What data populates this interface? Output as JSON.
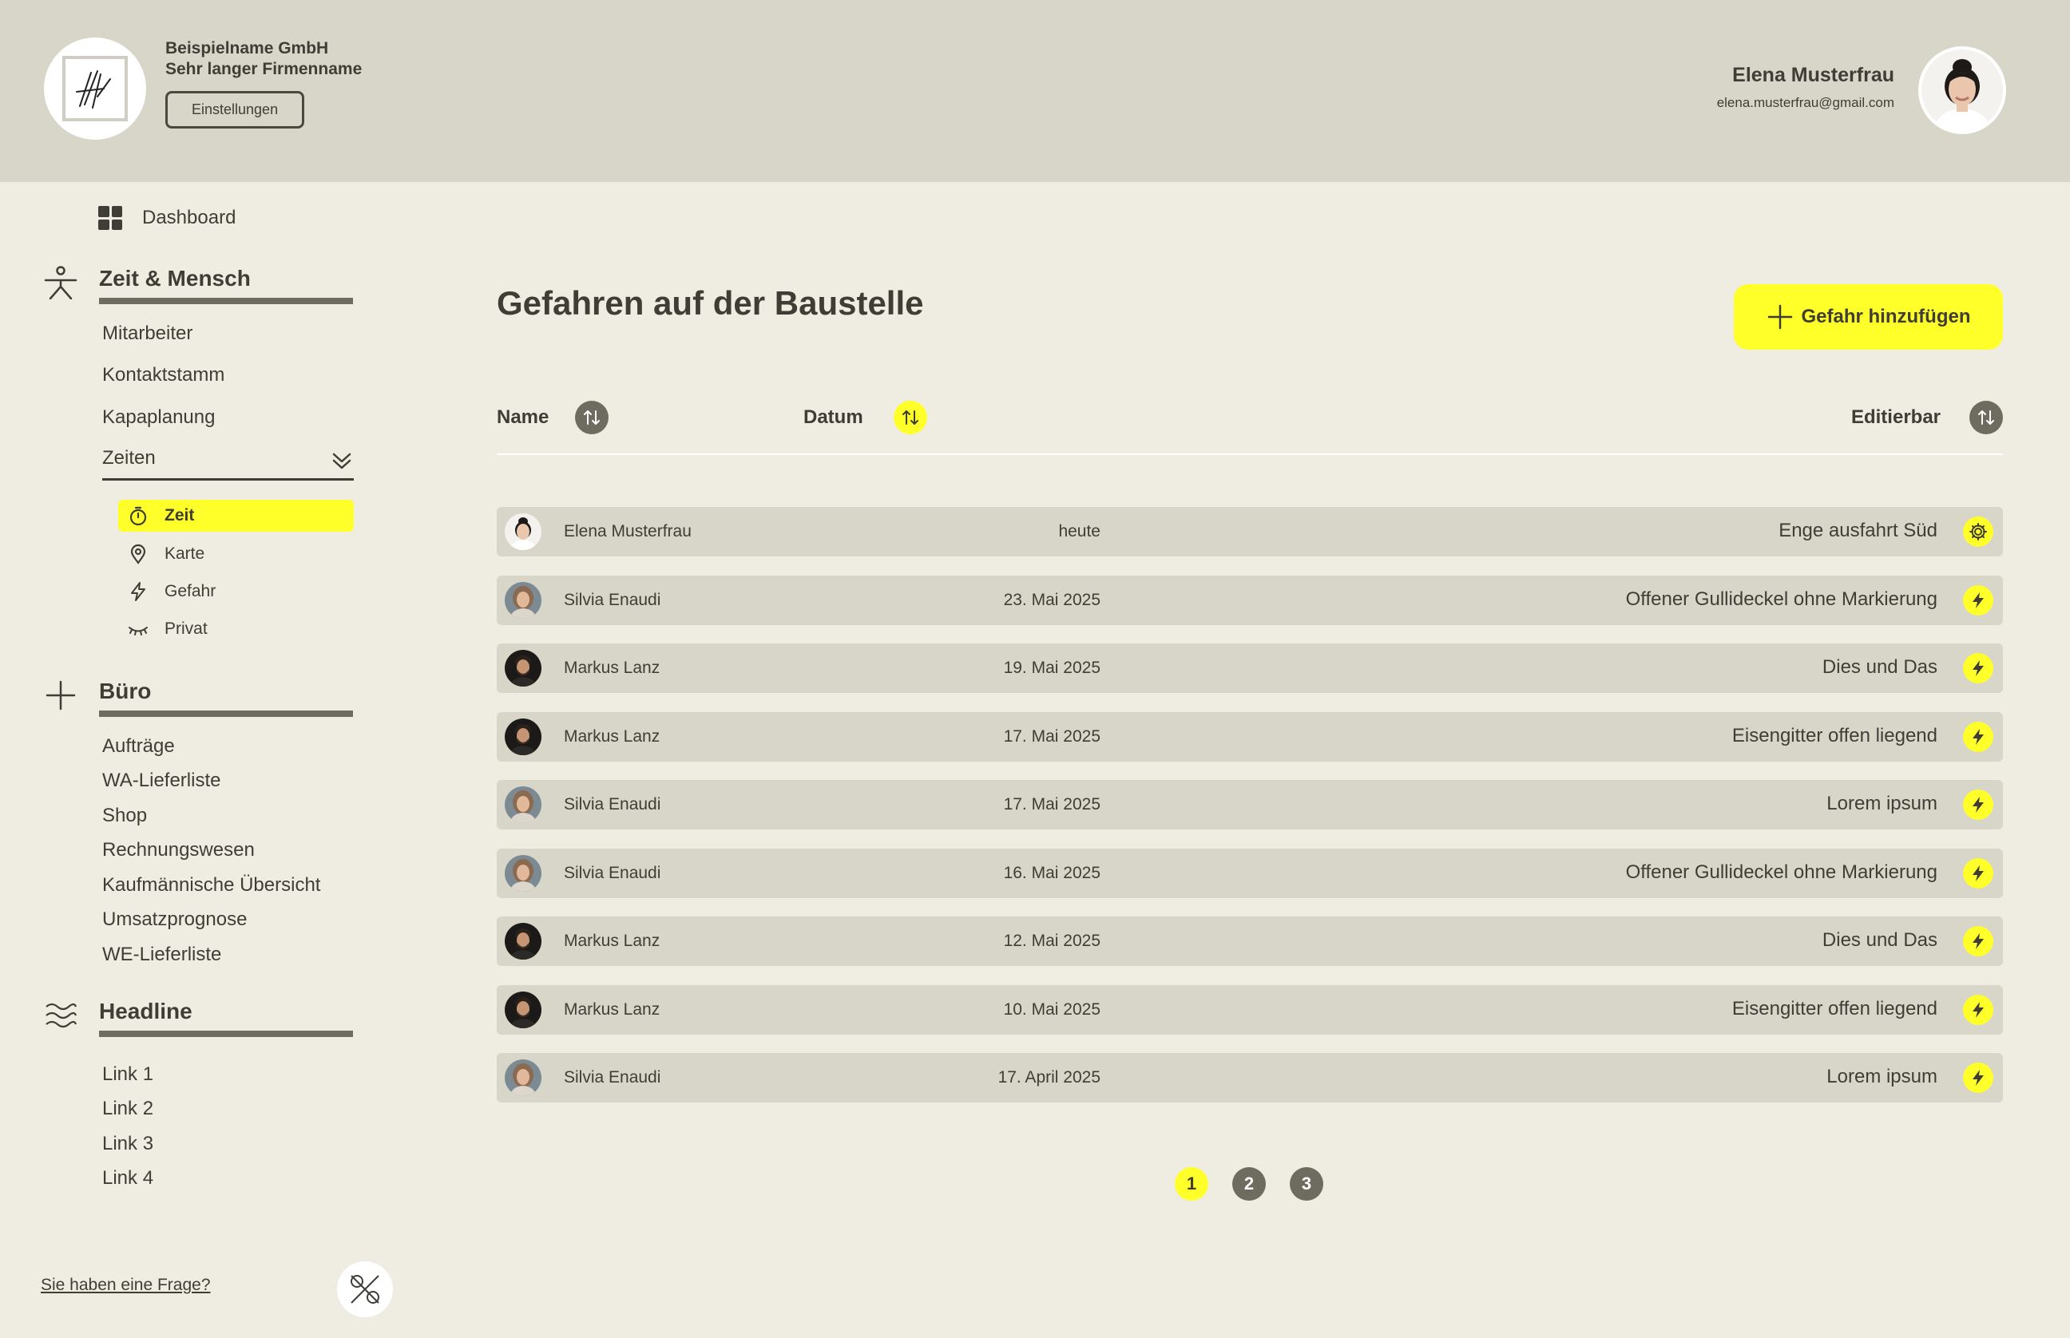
{
  "header": {
    "company_line1": "Beispielname GmbH",
    "company_line2": "Sehr langer Firmenname",
    "settings_label": "Einstellungen",
    "user_name": "Elena Musterfrau",
    "user_email": "elena.musterfrau@gmail.com"
  },
  "sidebar": {
    "dashboard": "Dashboard",
    "section1": {
      "title": "Zeit & Mensch",
      "links": [
        "Mitarbeiter",
        "Kontaktstamm",
        "Kapaplanung"
      ],
      "group_label": "Zeiten",
      "sub_items": [
        {
          "label": "Zeit",
          "icon": "stopwatch-icon",
          "active": true
        },
        {
          "label": "Karte",
          "icon": "map-pin-icon",
          "active": false
        },
        {
          "label": "Gefahr",
          "icon": "lightning-icon",
          "active": false
        },
        {
          "label": "Privat",
          "icon": "closed-eye-icon",
          "active": false
        }
      ]
    },
    "section2": {
      "title": "Büro",
      "links": [
        "Aufträge",
        "WA-Lieferliste",
        "Shop",
        "Rechnungswesen",
        "Kaufmännische Übersicht",
        "Umsatzprognose",
        "WE-Lieferliste"
      ]
    },
    "section3": {
      "title": "Headline",
      "links": [
        "Link 1",
        "Link 2",
        "Link 3",
        "Link 4"
      ]
    },
    "help_link": "Sie haben eine Frage?"
  },
  "main": {
    "title": "Gefahren auf der Baustelle",
    "add_button": "Gefahr hinzufügen",
    "columns": {
      "name": "Name",
      "date": "Datum",
      "editable": "Editierbar"
    },
    "rows": [
      {
        "name": "Elena Musterfrau",
        "date": "heute",
        "hazard": "Enge ausfahrt Süd",
        "action_icon": "gear-icon",
        "avatar": "elena"
      },
      {
        "name": "Silvia Enaudi",
        "date": "23. Mai 2025",
        "hazard": "Offener Gullideckel ohne Markierung",
        "action_icon": "lightning-icon",
        "avatar": "silvia"
      },
      {
        "name": "Markus Lanz",
        "date": "19. Mai 2025",
        "hazard": "Dies und Das",
        "action_icon": "lightning-icon",
        "avatar": "markus"
      },
      {
        "name": "Markus Lanz",
        "date": "17. Mai 2025",
        "hazard": "Eisengitter offen liegend",
        "action_icon": "lightning-icon",
        "avatar": "markus"
      },
      {
        "name": "Silvia Enaudi",
        "date": "17. Mai 2025",
        "hazard": "Lorem ipsum",
        "action_icon": "lightning-icon",
        "avatar": "silvia"
      },
      {
        "name": "Silvia Enaudi",
        "date": "16. Mai 2025",
        "hazard": "Offener Gullideckel ohne Markierung",
        "action_icon": "lightning-icon",
        "avatar": "silvia"
      },
      {
        "name": "Markus Lanz",
        "date": "12. Mai 2025",
        "hazard": "Dies und Das",
        "action_icon": "lightning-icon",
        "avatar": "markus"
      },
      {
        "name": "Markus Lanz",
        "date": "10. Mai 2025",
        "hazard": "Eisengitter offen liegend",
        "action_icon": "lightning-icon",
        "avatar": "markus"
      },
      {
        "name": "Silvia Enaudi",
        "date": "17. April 2025",
        "hazard": "Lorem ipsum",
        "action_icon": "lightning-icon",
        "avatar": "silvia"
      }
    ],
    "pages": [
      "1",
      "2",
      "3"
    ],
    "current_page": "1"
  },
  "colors": {
    "accent": "#FFFF2A",
    "header_bg": "#D8D6C8",
    "page_bg": "#EFEDE2",
    "text": "#3F3E36",
    "muted": "#6E6C5E"
  }
}
